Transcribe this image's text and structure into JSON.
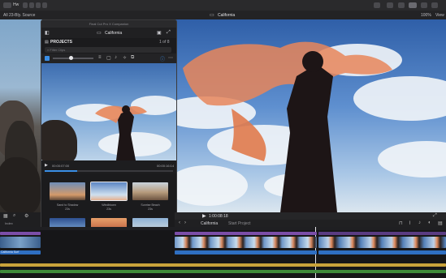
{
  "topbar": {
    "left_label": "Hw",
    "library_title": "All 23-Bly. Source",
    "project_title": "California",
    "zoom_label": "100%",
    "view_label": "View"
  },
  "ipad": {
    "window_title": "Final Cut Pro X Companion",
    "header_title": "California",
    "projects_label": "PROJECTS",
    "projects_count": "1 of 8",
    "search_placeholder": "Filter Clips",
    "timecode_left": "00:00:07:00",
    "timecode_right": "00:00:16:14",
    "thumbnails": [
      {
        "label": "Sand to Shadow",
        "sublabel": "23s"
      },
      {
        "label": "Windblown",
        "sublabel": "23s"
      },
      {
        "label": "Sunrise Beach",
        "sublabel": "23s"
      },
      {
        "label": "Mounting",
        "sublabel": "23s"
      },
      {
        "label": "Sunset",
        "sublabel": "23s"
      },
      {
        "label": "Hiking",
        "sublabel": "23s"
      }
    ]
  },
  "viewer": {
    "timecode": "1:00:08:18"
  },
  "timeline": {
    "project_name": "California",
    "index_label": "Index",
    "secondary_label": "Start Project",
    "clip_label": "California Surf"
  },
  "colors": {
    "accent": "#3a8ee6",
    "scarf": "#e8865a",
    "timeline_gold": "#c9a33a",
    "timeline_blue": "#2f6fc2",
    "timeline_green": "#3f8a3a"
  }
}
